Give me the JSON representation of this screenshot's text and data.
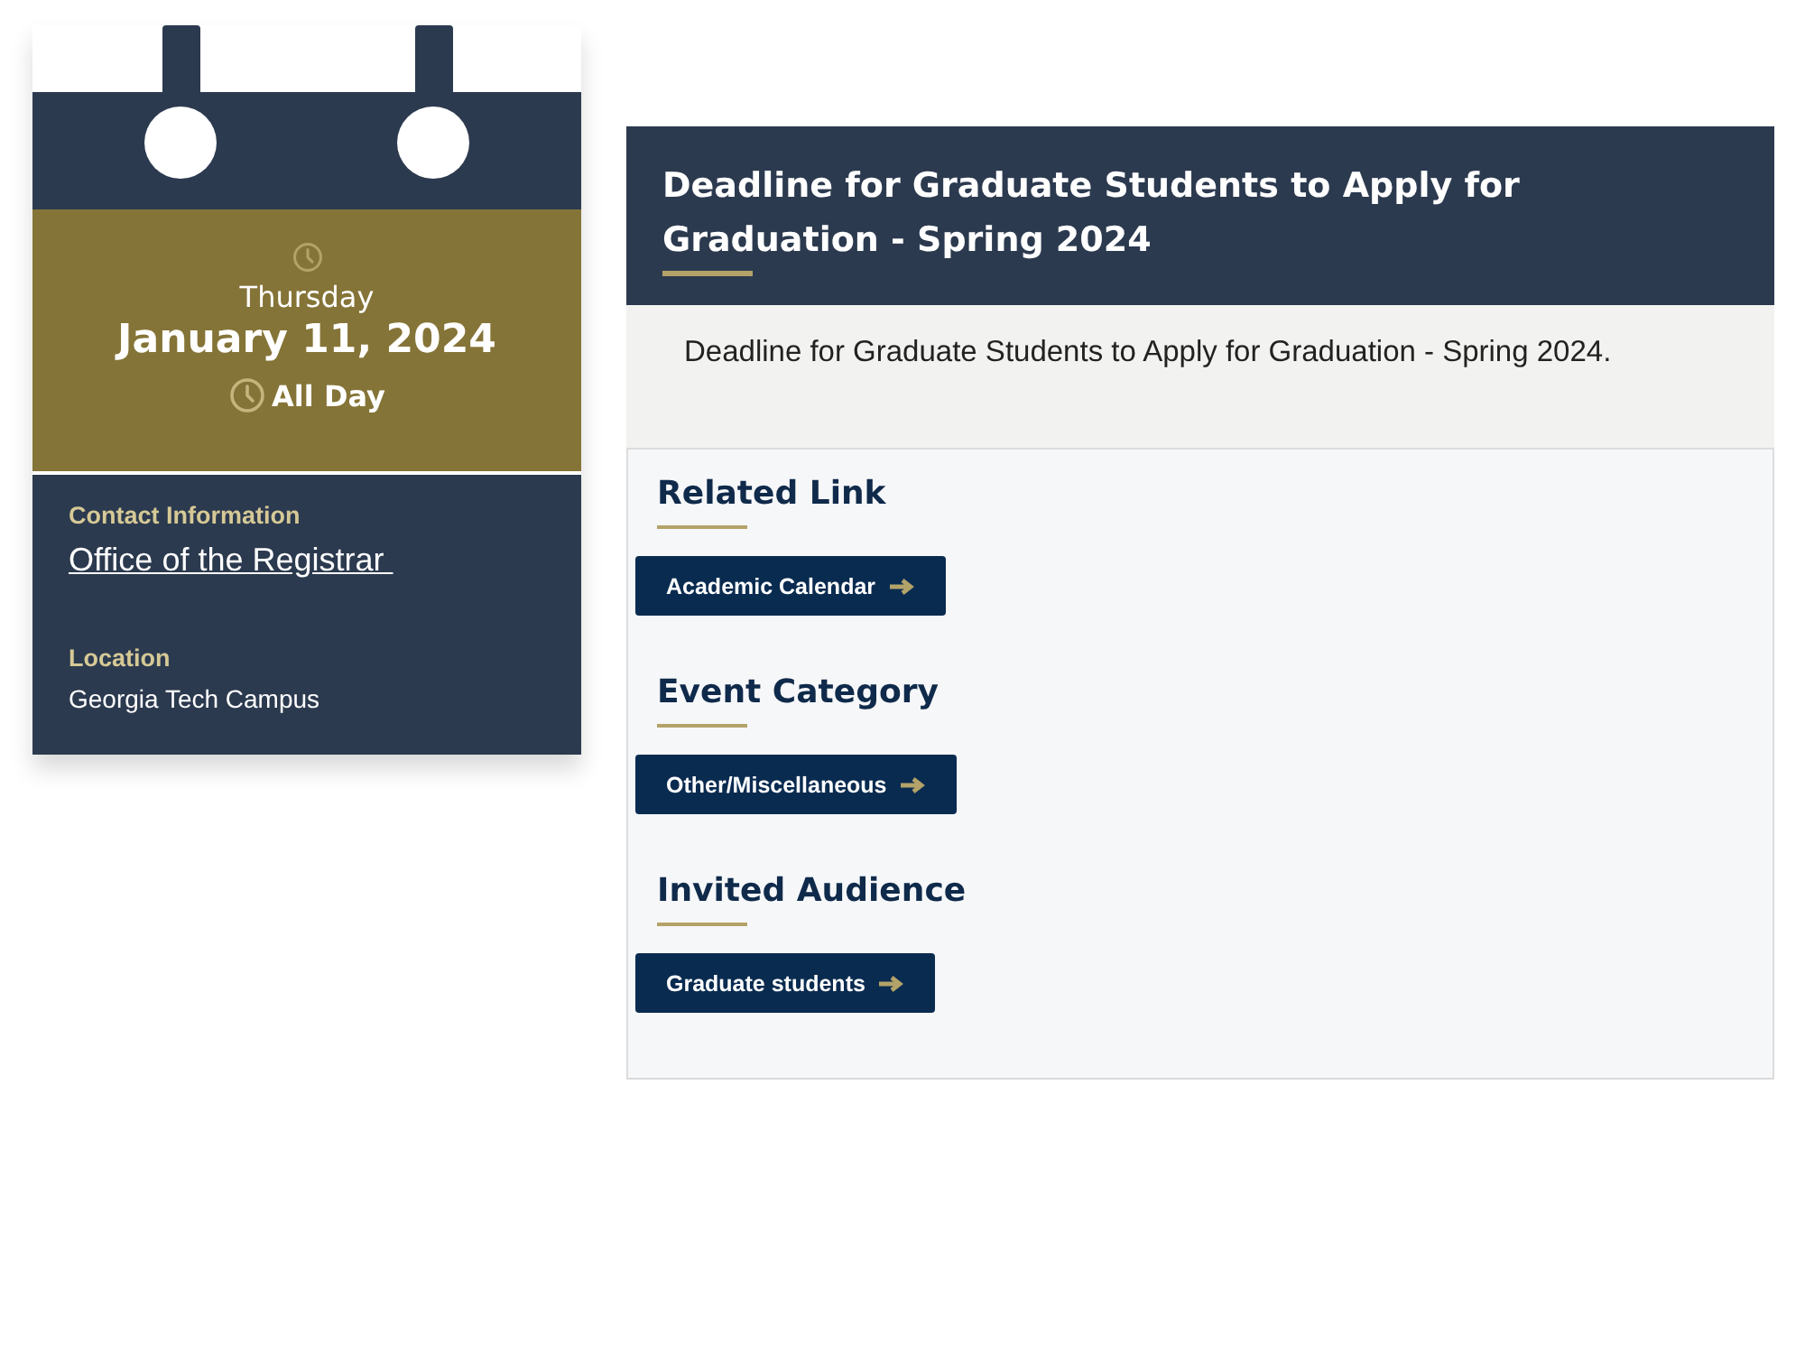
{
  "date_card": {
    "weekday": "Thursday",
    "date": "January 11, 2024",
    "time": "All Day"
  },
  "contact": {
    "label": "Contact Information",
    "link": "Office of the Registrar "
  },
  "location": {
    "label": "Location",
    "value": "Georgia Tech Campus"
  },
  "event": {
    "title": "Deadline for Graduate Students to Apply for Graduation - Spring 2024",
    "description": "Deadline for Graduate Students to Apply for Graduation - Spring 2024."
  },
  "sections": [
    {
      "heading": "Related Link",
      "button": "Academic Calendar"
    },
    {
      "heading": "Event Category",
      "button": "Other/Miscellaneous"
    },
    {
      "heading": "Invited Audience",
      "button": "Graduate students"
    }
  ]
}
